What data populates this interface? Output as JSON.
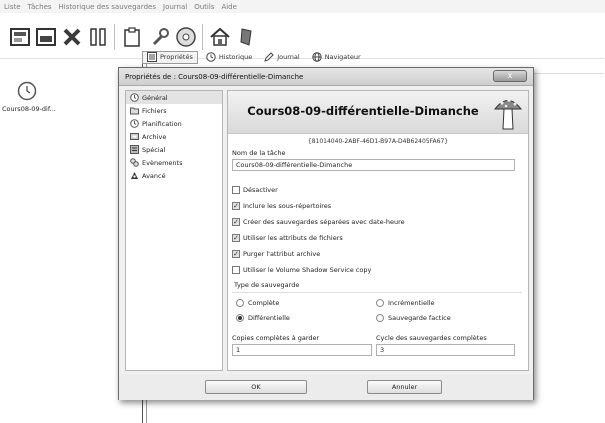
{
  "menu": [
    "Liste",
    "Tâches",
    "Historique des sauvegardes",
    "Journal",
    "Outils",
    "Aide"
  ],
  "toolbar_icons": [
    "page-icon",
    "drive-icon",
    "delete-icon",
    "pause-icon",
    "clipboard-icon",
    "wrench-icon",
    "disc-icon",
    "home-icon",
    "gem-icon"
  ],
  "task": {
    "name": "Cours08-09-dif..."
  },
  "view_tabs": [
    {
      "label": "Propriétés",
      "icon": "properties-icon"
    },
    {
      "label": "Historique",
      "icon": "clock-icon"
    },
    {
      "label": "Journal",
      "icon": "pen-icon"
    },
    {
      "label": "Navigateur",
      "icon": "globe-icon"
    }
  ],
  "dialog": {
    "title": "Propriétés de : Cours08-09-différentielle-Dimanche",
    "close": "x",
    "nav": [
      "Général",
      "Fichiers",
      "Planification",
      "Archive",
      "Spécial",
      "Evènements",
      "Avancé"
    ],
    "selected_nav": "Général",
    "banner_title": "Cours08-09-différentielle-Dimanche",
    "guid": "{81014040-2ABF-46D1-B97A-D4B62405FA67}",
    "name_label": "Nom de la tâche",
    "name_value": "Cours08-09-différentielle-Dimanche",
    "checkboxes": [
      {
        "label": "Désactiver",
        "checked": false
      },
      {
        "label": "Inclure les sous-répertoires",
        "checked": true
      },
      {
        "label": "Créer des sauvegardes séparées avec date-heure",
        "checked": true
      },
      {
        "label": "Utiliser les attributs de fichiers",
        "checked": true
      },
      {
        "label": "Purger l'attribut archive",
        "checked": true
      },
      {
        "label": "Utiliser le Volume Shadow Service copy",
        "checked": false
      }
    ],
    "backup_type": {
      "title": "Type de sauvegarde",
      "options": [
        "Complète",
        "Incrémentielle",
        "Différentielle",
        "Sauvegarde factice"
      ],
      "selected": "Différentielle"
    },
    "copies_label": "Copies complètes à garder",
    "copies_value": "1",
    "cycle_label": "Cycle des sauvegardes complètes",
    "cycle_value": "3",
    "ok": "OK",
    "cancel": "Annuler"
  }
}
